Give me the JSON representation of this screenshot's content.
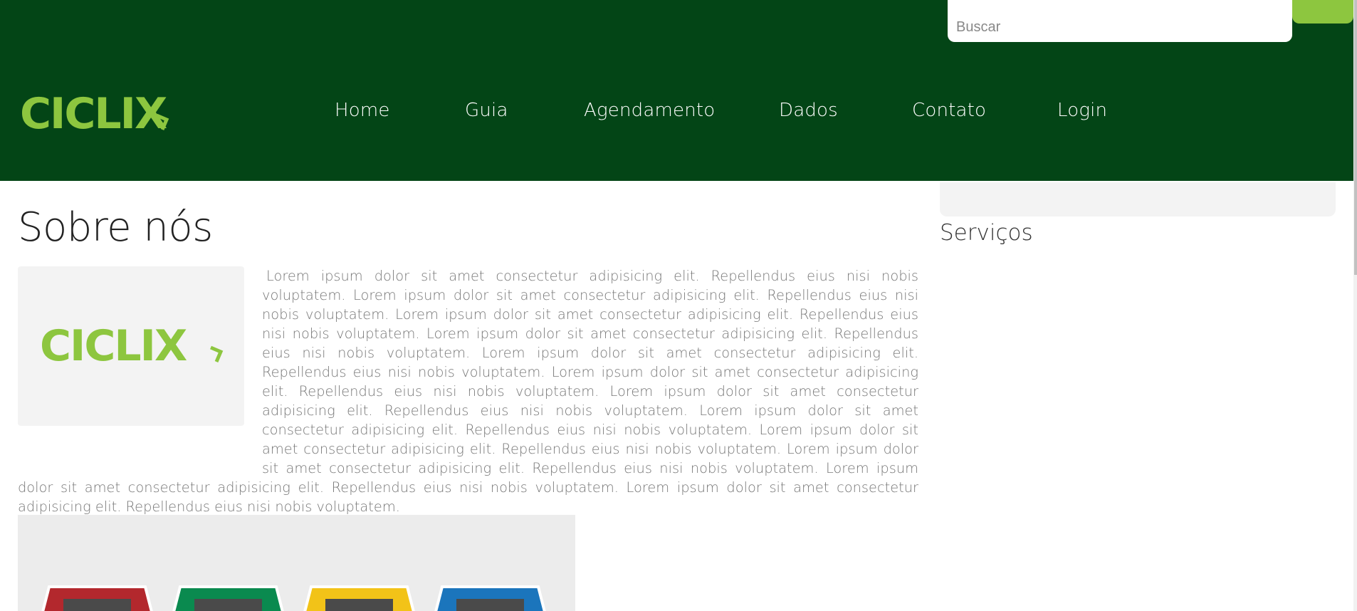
{
  "stray_text": "-->",
  "search": {
    "placeholder": "Buscar"
  },
  "brand": {
    "logo_text": "CICLIX",
    "accent_color": "#8dc63f",
    "header_color": "#034516"
  },
  "nav": {
    "items": [
      {
        "label": "Home"
      },
      {
        "label": "Guia"
      },
      {
        "label": "Agendamento"
      },
      {
        "label": "Dados"
      },
      {
        "label": "Contato"
      },
      {
        "label": "Login"
      }
    ]
  },
  "main": {
    "title": "Sobre nós",
    "about_text": "Lorem ipsum dolor sit amet consectetur adipisicing elit. Repellendus eius nisi nobis voluptatem. Lorem ipsum dolor sit amet consectetur adipisicing elit. Repellendus eius nisi nobis voluptatem. Lorem ipsum dolor sit amet consectetur adipisicing elit. Repellendus eius nisi nobis voluptatem. Lorem ipsum dolor sit amet consectetur adipisicing elit. Repellendus eius nisi nobis voluptatem. Lorem ipsum dolor sit amet consectetur adipisicing elit. Repellendus eius nisi nobis voluptatem. Lorem ipsum dolor sit amet consectetur adipisicing elit. Repellendus eius nisi nobis voluptatem. Lorem ipsum dolor sit amet consectetur adipisicing elit. Repellendus eius nisi nobis voluptatem. Lorem ipsum dolor sit amet consectetur adipisicing elit. Repellendus eius nisi nobis voluptatem. Lorem ipsum dolor sit amet consectetur adipisicing elit. Repellendus eius nisi nobis voluptatem. Lorem ipsum dolor sit amet consectetur adipisicing elit. Repellendus eius nisi nobis voluptatem. Lorem ipsum dolor sit amet consectetur adipisicing elit. Repellendus eius nisi nobis voluptatem. Lorem ipsum dolor sit amet consectetur adipisicing elit. Repellendus eius nisi nobis voluptatem.",
    "bins_colors": [
      "#b3282d",
      "#0a8a4f",
      "#f2c318",
      "#1b75bc"
    ]
  },
  "sidebar": {
    "title": "Serviços"
  }
}
